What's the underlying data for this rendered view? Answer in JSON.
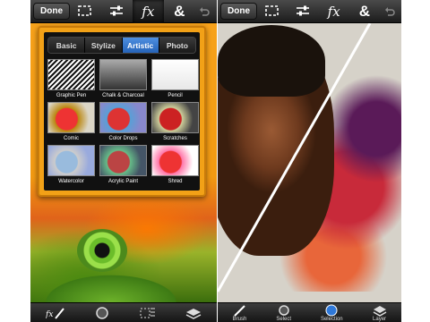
{
  "left_screen": {
    "topbar": {
      "done_label": "Done",
      "fx_label": "fx",
      "amp_label": "&"
    },
    "popover": {
      "tabs": [
        {
          "label": "Basic",
          "active": false
        },
        {
          "label": "Stylize",
          "active": false
        },
        {
          "label": "Artistic",
          "active": true
        },
        {
          "label": "Photo",
          "active": false
        }
      ],
      "effects": [
        {
          "label": "Graphic Pen"
        },
        {
          "label": "Chalk & Charcoal"
        },
        {
          "label": "Pencil"
        },
        {
          "label": "Comic"
        },
        {
          "label": "Color Drops"
        },
        {
          "label": "Scratches"
        },
        {
          "label": "Watercolor"
        },
        {
          "label": "Acrylic Paint"
        },
        {
          "label": "Shred"
        }
      ]
    },
    "bottombar": {
      "fx_label": "fx"
    }
  },
  "right_screen": {
    "topbar": {
      "done_label": "Done",
      "fx_label": "fx",
      "amp_label": "&"
    },
    "bottombar": {
      "labels": [
        "Brush",
        "Select",
        "Selection",
        "Layer"
      ]
    }
  },
  "colors": {
    "accent_blue": "#2f78d8",
    "popover_orange": "#f2a117"
  }
}
